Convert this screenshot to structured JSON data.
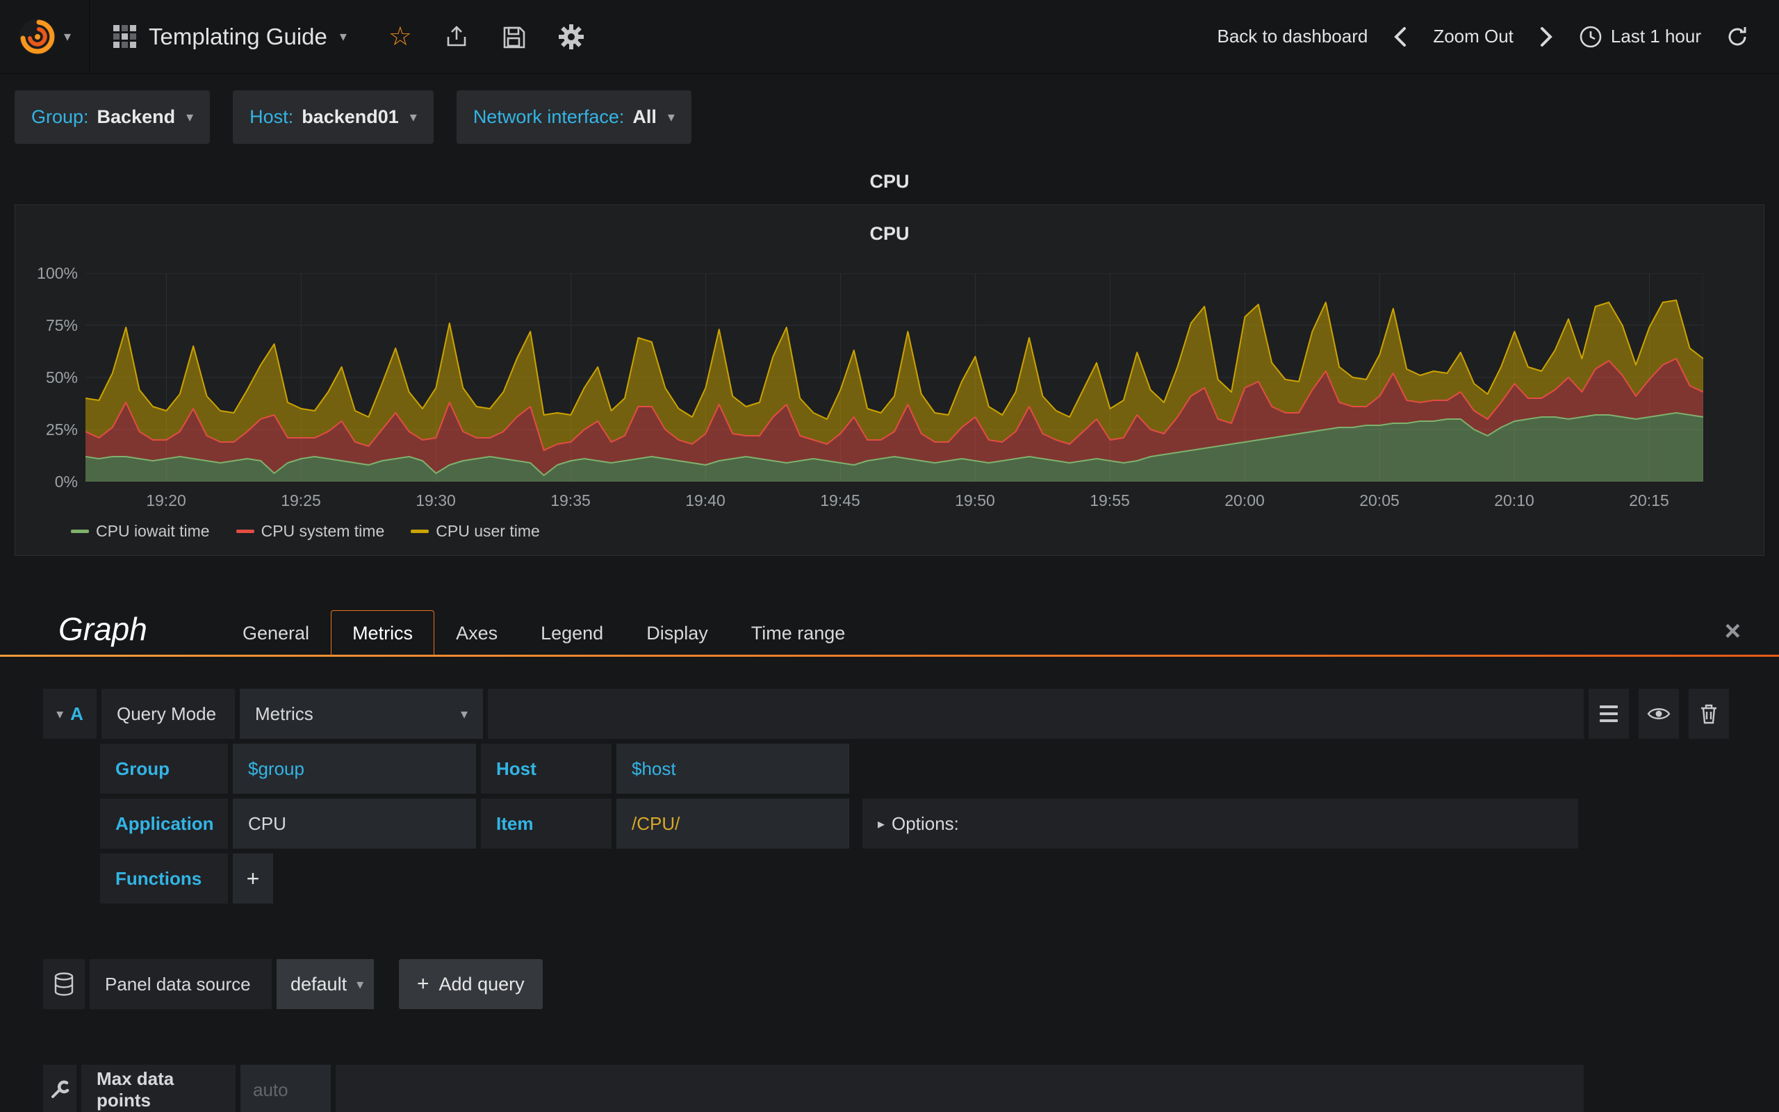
{
  "colors": {
    "accent_blue": "#33b5e5",
    "accent_orange": "#eb7b18",
    "page_bg": "#161719"
  },
  "navbar": {
    "dashboard_title": "Templating Guide",
    "back_to_dashboard": "Back to dashboard",
    "zoom_out": "Zoom Out",
    "time_range": "Last 1 hour"
  },
  "variables": [
    {
      "label": "Group:",
      "value": "Backend"
    },
    {
      "label": "Host:",
      "value": "backend01"
    },
    {
      "label": "Network interface:",
      "value": "All"
    }
  ],
  "panel": {
    "title": "CPU",
    "inner_title": "CPU"
  },
  "chart_data": {
    "type": "area",
    "stacked": true,
    "title": "CPU",
    "ylim": [
      0,
      100
    ],
    "y_ticks": [
      "0%",
      "25%",
      "50%",
      "75%",
      "100%"
    ],
    "y_tick_values": [
      0,
      25,
      50,
      75,
      100
    ],
    "x_ticks": [
      "19:20",
      "19:25",
      "19:30",
      "19:35",
      "19:40",
      "19:45",
      "19:50",
      "19:55",
      "20:00",
      "20:05",
      "20:10",
      "20:15"
    ],
    "x_tick_indices": [
      6,
      16,
      26,
      36,
      46,
      56,
      66,
      76,
      86,
      96,
      106,
      116
    ],
    "legend_position": "bottom-left",
    "grid": true,
    "series": [
      {
        "name": "CPU iowait time",
        "color": "#7eb26d",
        "values": [
          12,
          11,
          12,
          12,
          11,
          10,
          11,
          12,
          11,
          10,
          9,
          10,
          11,
          10,
          4,
          9,
          11,
          12,
          11,
          10,
          9,
          8,
          10,
          11,
          12,
          10,
          4,
          8,
          10,
          11,
          12,
          11,
          10,
          9,
          3,
          8,
          10,
          11,
          10,
          9,
          10,
          11,
          12,
          11,
          10,
          9,
          8,
          10,
          11,
          12,
          11,
          10,
          9,
          10,
          11,
          10,
          9,
          8,
          10,
          11,
          12,
          11,
          10,
          9,
          10,
          11,
          10,
          9,
          10,
          11,
          12,
          11,
          10,
          9,
          10,
          11,
          10,
          9,
          10,
          12,
          13,
          14,
          15,
          16,
          17,
          18,
          19,
          20,
          21,
          22,
          23,
          24,
          25,
          26,
          26,
          27,
          27,
          28,
          28,
          29,
          29,
          30,
          30,
          25,
          22,
          26,
          29,
          30,
          31,
          31,
          30,
          31,
          32,
          32,
          31,
          30,
          31,
          32,
          33,
          32,
          31
        ]
      },
      {
        "name": "CPU system time",
        "color": "#e24d42",
        "values": [
          12,
          10,
          14,
          26,
          13,
          10,
          9,
          12,
          24,
          12,
          10,
          9,
          13,
          20,
          28,
          12,
          10,
          9,
          13,
          19,
          10,
          9,
          15,
          22,
          12,
          10,
          17,
          30,
          14,
          10,
          9,
          13,
          21,
          27,
          12,
          10,
          9,
          14,
          19,
          10,
          12,
          25,
          24,
          14,
          10,
          9,
          15,
          27,
          12,
          10,
          11,
          21,
          28,
          12,
          9,
          8,
          14,
          23,
          10,
          9,
          12,
          26,
          13,
          10,
          9,
          15,
          21,
          11,
          9,
          13,
          24,
          12,
          10,
          9,
          14,
          19,
          10,
          12,
          22,
          13,
          10,
          17,
          26,
          29,
          13,
          10,
          26,
          28,
          15,
          11,
          10,
          20,
          28,
          12,
          10,
          9,
          14,
          24,
          11,
          9,
          10,
          9,
          13,
          9,
          8,
          12,
          18,
          10,
          9,
          13,
          20,
          12,
          22,
          26,
          20,
          11,
          18,
          24,
          26,
          14,
          12
        ]
      },
      {
        "name": "CPU user time",
        "color": "#cca300",
        "values": [
          16,
          18,
          26,
          36,
          20,
          16,
          14,
          18,
          30,
          19,
          15,
          14,
          20,
          26,
          34,
          17,
          14,
          13,
          19,
          26,
          15,
          14,
          22,
          31,
          19,
          15,
          24,
          38,
          21,
          15,
          14,
          19,
          28,
          36,
          17,
          15,
          13,
          20,
          26,
          15,
          18,
          33,
          31,
          20,
          15,
          13,
          22,
          36,
          18,
          14,
          16,
          29,
          37,
          18,
          13,
          12,
          21,
          32,
          15,
          13,
          17,
          35,
          19,
          14,
          13,
          22,
          29,
          16,
          13,
          19,
          33,
          18,
          14,
          13,
          20,
          27,
          15,
          18,
          30,
          19,
          15,
          24,
          35,
          39,
          19,
          15,
          34,
          37,
          21,
          16,
          15,
          28,
          33,
          17,
          14,
          13,
          20,
          31,
          15,
          13,
          14,
          13,
          19,
          13,
          12,
          17,
          25,
          15,
          13,
          19,
          28,
          16,
          30,
          28,
          24,
          15,
          25,
          30,
          28,
          18,
          16
        ]
      }
    ]
  },
  "editor": {
    "panel_type": "Graph",
    "tabs": [
      "General",
      "Metrics",
      "Axes",
      "Legend",
      "Display",
      "Time range"
    ],
    "active_tab": "Metrics",
    "query": {
      "ref": "A",
      "query_mode_label": "Query Mode",
      "query_mode_value": "Metrics",
      "group_label": "Group",
      "group_value": "$group",
      "host_label": "Host",
      "host_value": "$host",
      "application_label": "Application",
      "application_value": "CPU",
      "item_label": "Item",
      "item_value": "/CPU/",
      "options_label": "Options:",
      "functions_label": "Functions",
      "add_function_label": "+"
    },
    "datasource": {
      "label": "Panel data source",
      "value": "default",
      "add_query_label": "Add query"
    },
    "max_data_points": {
      "label": "Max data points",
      "placeholder": "auto"
    }
  }
}
